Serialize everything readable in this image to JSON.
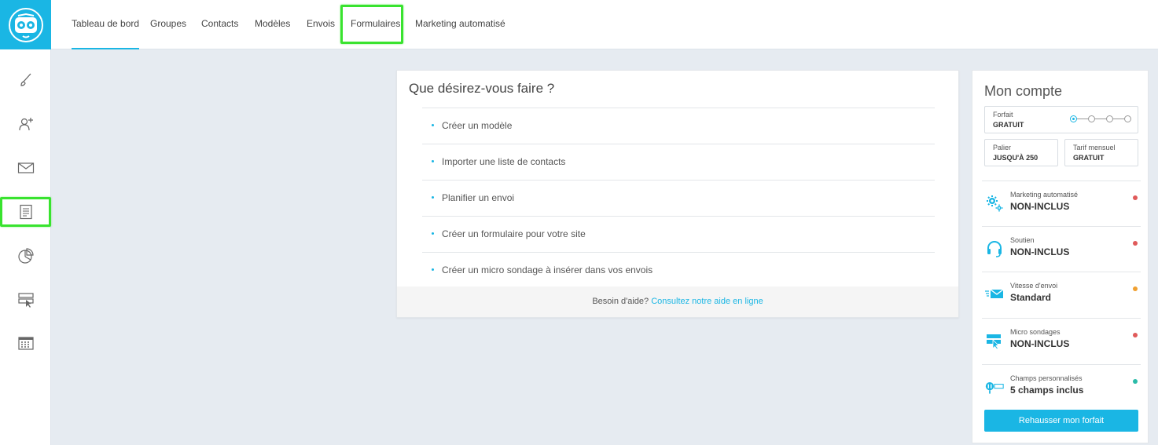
{
  "nav": {
    "items": [
      {
        "label": "Tableau de bord"
      },
      {
        "label": "Groupes"
      },
      {
        "label": "Contacts"
      },
      {
        "label": "Modèles"
      },
      {
        "label": "Envois"
      },
      {
        "label": "Formulaires"
      },
      {
        "label": "Marketing automatisé"
      }
    ],
    "active": "Tableau de bord",
    "highlighted": "Formulaires"
  },
  "sidebar": {
    "items": [
      {
        "icon": "brush-icon"
      },
      {
        "icon": "add-contact-icon"
      },
      {
        "icon": "envelope-icon"
      },
      {
        "icon": "form-icon"
      },
      {
        "icon": "pie-chart-icon"
      },
      {
        "icon": "micro-survey-icon"
      },
      {
        "icon": "calendar-icon"
      }
    ],
    "highlighted": "form-icon"
  },
  "main": {
    "title": "Que désirez-vous faire ?",
    "actions": [
      {
        "label": "Créer un modèle"
      },
      {
        "label": "Importer une liste de contacts"
      },
      {
        "label": "Planifier un envoi"
      },
      {
        "label": "Créer un formulaire pour votre site"
      },
      {
        "label": "Créer un micro sondage à insérer dans vos envois"
      }
    ],
    "help_text": "Besoin d'aide?",
    "help_link": "Consultez notre aide en ligne"
  },
  "account": {
    "title": "Mon compte",
    "forfait": {
      "label": "Forfait",
      "value": "GRATUIT",
      "step_active": 1,
      "step_count": 4
    },
    "palier": {
      "label": "Palier",
      "value": "JUSQU'À 250"
    },
    "tarif": {
      "label": "Tarif mensuel",
      "value": "GRATUIT"
    },
    "features": [
      {
        "label": "Marketing automatisé",
        "value": "NON-INCLUS",
        "icon": "gears-icon",
        "status_color": "#e05a5a"
      },
      {
        "label": "Soutien",
        "value": "NON-INCLUS",
        "icon": "headset-icon",
        "status_color": "#e05a5a"
      },
      {
        "label": "Vitesse d'envoi",
        "value": "Standard",
        "icon": "fast-mail-icon",
        "status_color": "#f0a030"
      },
      {
        "label": "Micro sondages",
        "value": "NON-INCLUS",
        "icon": "micro-survey-icon",
        "status_color": "#e05a5a"
      },
      {
        "label": "Champs personnalisés",
        "value": "5 champs inclus",
        "icon": "key-field-icon",
        "status_color": "#2abba8"
      }
    ],
    "upgrade_label": "Rehausser mon forfait"
  },
  "colors": {
    "accent": "#1ab6e4",
    "highlight": "#39e32f",
    "background": "#e6ebf1"
  }
}
